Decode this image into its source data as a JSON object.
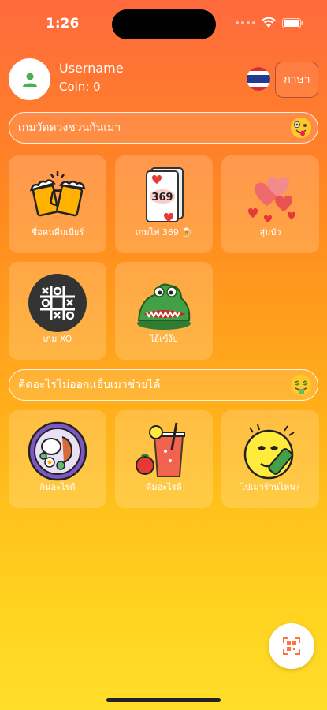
{
  "status": {
    "time": "1:26"
  },
  "header": {
    "username": "Username",
    "coin": "Coin: 0",
    "language_button": "ภาษา"
  },
  "sections": [
    {
      "title": "เกมวัดดวงชวนกันเมา",
      "emoji": "zany-face-emoji"
    },
    {
      "title": "คิดอะไรไม่ออกแอ็บเมาช่วยได้",
      "emoji": "money-mouth-face-emoji"
    }
  ],
  "games": [
    {
      "label": "ชื่อคนดื่มเบียร์",
      "icon": "beer-mugs-icon"
    },
    {
      "label": "เกมไพ่ 369 🍺",
      "icon": "playing-card-369-icon"
    },
    {
      "label": "สุ่มบ้ว",
      "icon": "hearts-icon"
    },
    {
      "label": "เกม XO",
      "icon": "tic-tac-toe-icon"
    },
    {
      "label": "ไอ้เข้งับ",
      "icon": "crocodile-icon"
    }
  ],
  "helpers": [
    {
      "label": "กินอะไรดี",
      "icon": "food-plate-icon"
    },
    {
      "label": "ดื่มอะไรดี",
      "icon": "drinks-icon"
    },
    {
      "label": "ไปเมาร้านไหน?",
      "icon": "drunk-face-icon"
    }
  ],
  "colors": {
    "bg_top": "#ff6a3d",
    "bg_bottom": "#ffde2a",
    "accent": "#ff8a1f"
  }
}
